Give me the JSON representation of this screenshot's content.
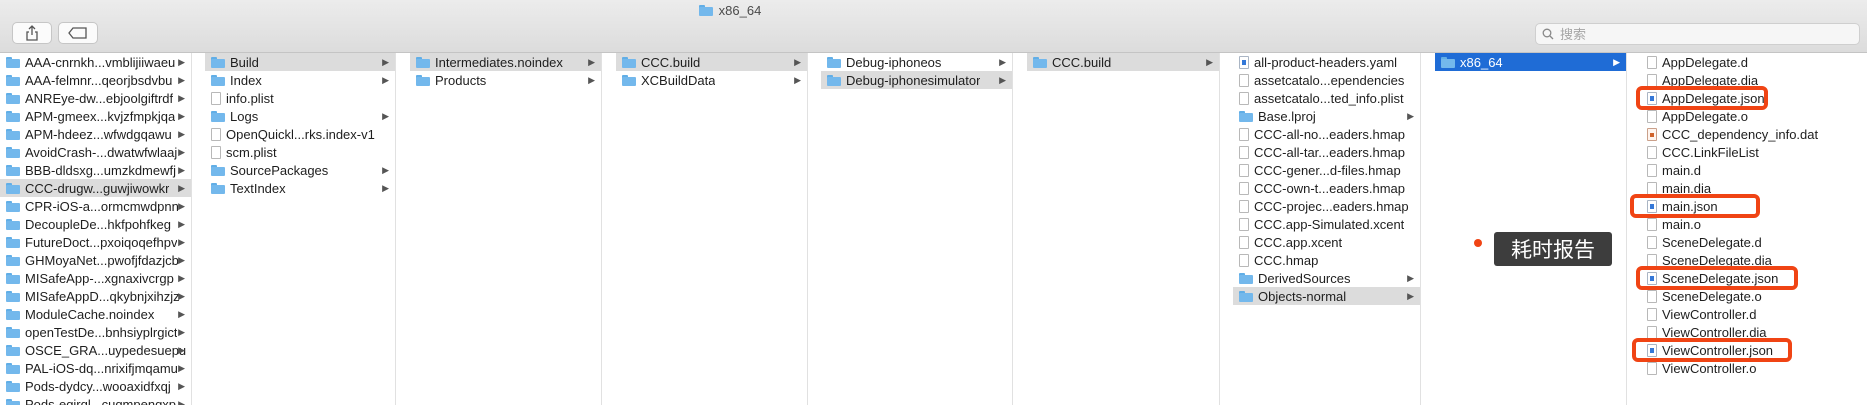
{
  "window": {
    "title": "x86_64"
  },
  "toolbar": {
    "share_icon": "share-icon",
    "tag_icon": "tag-icon"
  },
  "search": {
    "placeholder": "搜索"
  },
  "columns": [
    {
      "items": [
        {
          "label": "AAA-cnrnkh...vmblijiiwaeu",
          "type": "folder",
          "chevron": true
        },
        {
          "label": "AAA-felmnr...qeorjbsdvbu",
          "type": "folder",
          "chevron": true
        },
        {
          "label": "ANREye-dw...ebjoolgiftrdf",
          "type": "folder",
          "chevron": true
        },
        {
          "label": "APM-gmeex...kvjzfmpkjqa",
          "type": "folder",
          "chevron": true
        },
        {
          "label": "APM-hdeez...wfwdgqawu",
          "type": "folder",
          "chevron": true
        },
        {
          "label": "AvoidCrash-...dwatwfwlaaj",
          "type": "folder",
          "chevron": true
        },
        {
          "label": "BBB-dldsxg...umzkdmewfj",
          "type": "folder",
          "chevron": true
        },
        {
          "label": "CCC-drugw...guwjiwowkr",
          "type": "folder",
          "chevron": true,
          "selected": true
        },
        {
          "label": "CPR-iOS-a...ormcmwdpnn",
          "type": "folder",
          "chevron": true
        },
        {
          "label": "DecoupleDe...hkfpohfkeg",
          "type": "folder",
          "chevron": true
        },
        {
          "label": "FutureDoct...pxoiqoqefhpv",
          "type": "folder",
          "chevron": true
        },
        {
          "label": "GHMoyaNet...pwofjfdazjcb",
          "type": "folder",
          "chevron": true
        },
        {
          "label": "MISafeApp-...xgnaxivcrgp",
          "type": "folder",
          "chevron": true
        },
        {
          "label": "MISafeAppD...qkybnjxihzjz",
          "type": "folder",
          "chevron": true
        },
        {
          "label": "ModuleCache.noindex",
          "type": "folder",
          "chevron": true
        },
        {
          "label": "openTestDe...bnhsiyplrgict",
          "type": "folder",
          "chevron": true
        },
        {
          "label": "OSCE_GRA...uypedesuepu",
          "type": "folder",
          "chevron": true
        },
        {
          "label": "PAL-iOS-dq...nrixifjmqamu",
          "type": "folder",
          "chevron": true
        },
        {
          "label": "Pods-dydcy...wooaxidfxqj",
          "type": "folder",
          "chevron": true
        },
        {
          "label": "Pods-egjrql...cuqmpengxp",
          "type": "folder",
          "chevron": true
        }
      ]
    },
    {
      "items": [
        {
          "label": "Build",
          "type": "folder",
          "chevron": true,
          "selected": true
        },
        {
          "label": "Index",
          "type": "folder",
          "chevron": true
        },
        {
          "label": "info.plist",
          "type": "doc"
        },
        {
          "label": "Logs",
          "type": "folder",
          "chevron": true
        },
        {
          "label": "OpenQuickl...rks.index-v1",
          "type": "doc"
        },
        {
          "label": "scm.plist",
          "type": "doc"
        },
        {
          "label": "SourcePackages",
          "type": "folder",
          "chevron": true
        },
        {
          "label": "TextIndex",
          "type": "folder",
          "chevron": true
        }
      ]
    },
    {
      "items": [
        {
          "label": "Intermediates.noindex",
          "type": "folder",
          "chevron": true,
          "selected": true
        },
        {
          "label": "Products",
          "type": "folder",
          "chevron": true
        }
      ]
    },
    {
      "items": [
        {
          "label": "CCC.build",
          "type": "folder",
          "chevron": true,
          "selected": true
        },
        {
          "label": "XCBuildData",
          "type": "folder",
          "chevron": true
        }
      ]
    },
    {
      "items": [
        {
          "label": "Debug-iphoneos",
          "type": "folder",
          "chevron": true
        },
        {
          "label": "Debug-iphonesimulator",
          "type": "folder",
          "chevron": true,
          "selected": true
        }
      ]
    },
    {
      "items": [
        {
          "label": "CCC.build",
          "type": "folder",
          "chevron": true,
          "selected": true
        }
      ]
    },
    {
      "items": [
        {
          "label": "all-product-headers.yaml",
          "type": "json"
        },
        {
          "label": "assetcatalo...ependencies",
          "type": "doc"
        },
        {
          "label": "assetcatalo...ted_info.plist",
          "type": "doc"
        },
        {
          "label": "Base.lproj",
          "type": "folder",
          "chevron": true
        },
        {
          "label": "CCC-all-no...eaders.hmap",
          "type": "doc"
        },
        {
          "label": "CCC-all-tar...eaders.hmap",
          "type": "doc"
        },
        {
          "label": "CCC-gener...d-files.hmap",
          "type": "doc"
        },
        {
          "label": "CCC-own-t...eaders.hmap",
          "type": "doc"
        },
        {
          "label": "CCC-projec...eaders.hmap",
          "type": "doc"
        },
        {
          "label": "CCC.app-Simulated.xcent",
          "type": "doc"
        },
        {
          "label": "CCC.app.xcent",
          "type": "doc"
        },
        {
          "label": "CCC.hmap",
          "type": "doc"
        },
        {
          "label": "DerivedSources",
          "type": "folder",
          "chevron": true
        },
        {
          "label": "Objects-normal",
          "type": "folder",
          "chevron": true,
          "selected": true
        }
      ]
    },
    {
      "items": [
        {
          "label": "x86_64",
          "type": "folder",
          "chevron": true,
          "active": true
        }
      ]
    },
    {
      "items": [
        {
          "label": "AppDelegate.d",
          "type": "doc"
        },
        {
          "label": "AppDelegate.dia",
          "type": "doc"
        },
        {
          "label": "AppDelegate.json",
          "type": "json"
        },
        {
          "label": "AppDelegate.o",
          "type": "doc"
        },
        {
          "label": "CCC_dependency_info.dat",
          "type": "dat"
        },
        {
          "label": "CCC.LinkFileList",
          "type": "doc"
        },
        {
          "label": "main.d",
          "type": "doc"
        },
        {
          "label": "main.dia",
          "type": "doc"
        },
        {
          "label": "main.json",
          "type": "json"
        },
        {
          "label": "main.o",
          "type": "doc"
        },
        {
          "label": "SceneDelegate.d",
          "type": "doc"
        },
        {
          "label": "SceneDelegate.dia",
          "type": "doc"
        },
        {
          "label": "SceneDelegate.json",
          "type": "json"
        },
        {
          "label": "SceneDelegate.o",
          "type": "doc"
        },
        {
          "label": "ViewController.d",
          "type": "doc"
        },
        {
          "label": "ViewController.dia",
          "type": "doc"
        },
        {
          "label": "ViewController.json",
          "type": "json"
        },
        {
          "label": "ViewController.o",
          "type": "doc"
        }
      ]
    }
  ],
  "annotation": {
    "label": "耗时报告",
    "color": "#f04414"
  },
  "colors": {
    "selection_active": "#1f6cd6",
    "selection_inactive": "#dcdcdc",
    "folder": "#73b8ec"
  }
}
